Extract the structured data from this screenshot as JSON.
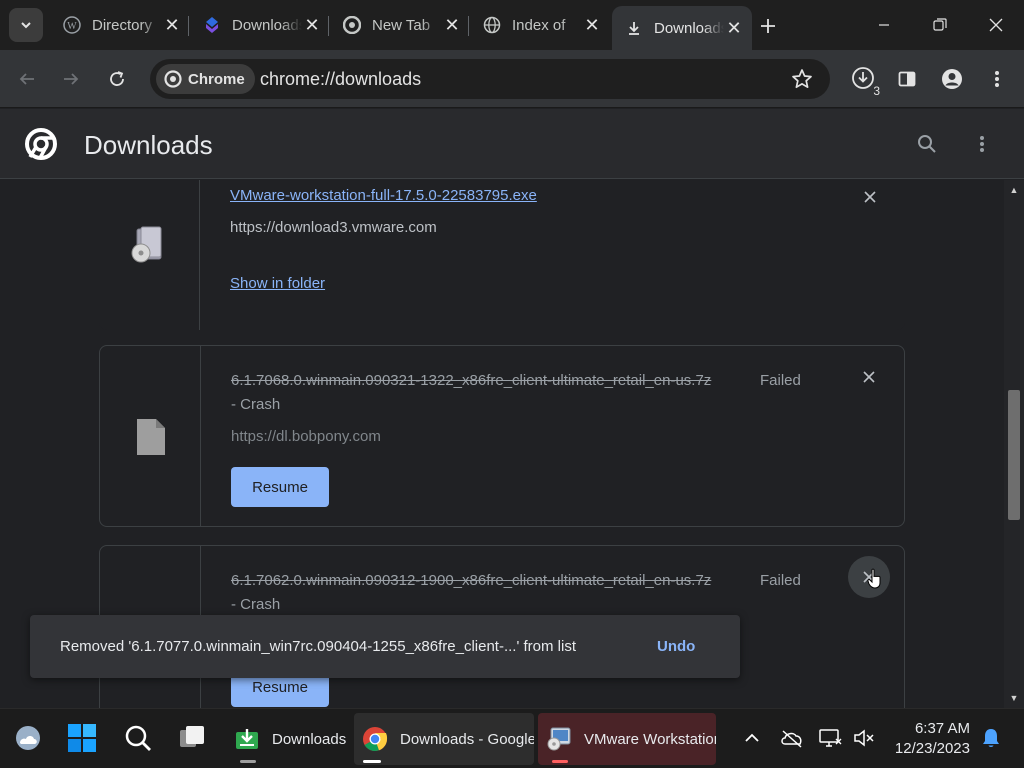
{
  "browser": {
    "tabs": [
      {
        "title": "Directory",
        "icon": "wordpress-icon"
      },
      {
        "title": "Downloads",
        "icon": "puzzle-icon"
      },
      {
        "title": "New Tab",
        "icon": "chrome-icon"
      },
      {
        "title": "Index of",
        "icon": "globe-icon"
      },
      {
        "title": "Downloads",
        "icon": "download-icon",
        "active": true
      }
    ],
    "omnibox": {
      "chip_label": "Chrome",
      "url": "chrome://downloads"
    },
    "download_badge": "3"
  },
  "page": {
    "title": "Downloads"
  },
  "downloads": [
    {
      "filename": "VMware-workstation-full-17.5.0-22583795.exe",
      "source": "https://download3.vmware.com",
      "action": "Show in folder",
      "state": "complete"
    },
    {
      "filename": "6.1.7068.0.winmain.090321-1322_x86fre_client-ultimate_retail_en-us.7z",
      "status": "Failed",
      "reason": "- Crash",
      "source": "https://dl.bobpony.com",
      "action": "Resume",
      "state": "failed"
    },
    {
      "filename": "6.1.7062.0.winmain.090312-1900_x86fre_client-ultimate_retail_en-us.7z",
      "status": "Failed",
      "reason": "- Crash",
      "action": "Resume",
      "state": "failed"
    }
  ],
  "toast": {
    "message": "Removed '6.1.7077.0.winmain_win7rc.090404-1255_x86fre_client-...' from list",
    "action": "Undo"
  },
  "taskbar": {
    "apps": [
      {
        "label": "Downloads",
        "icon": "file-explorer-download-icon"
      },
      {
        "label": "Downloads - Google Chrome",
        "icon": "chrome-icon"
      },
      {
        "label": "VMware Workstation",
        "icon": "vmware-icon"
      }
    ],
    "time": "6:37 AM",
    "date": "12/23/2023"
  },
  "colors": {
    "accent": "#8ab4f8",
    "background": "#202124",
    "header": "#292a2d"
  }
}
